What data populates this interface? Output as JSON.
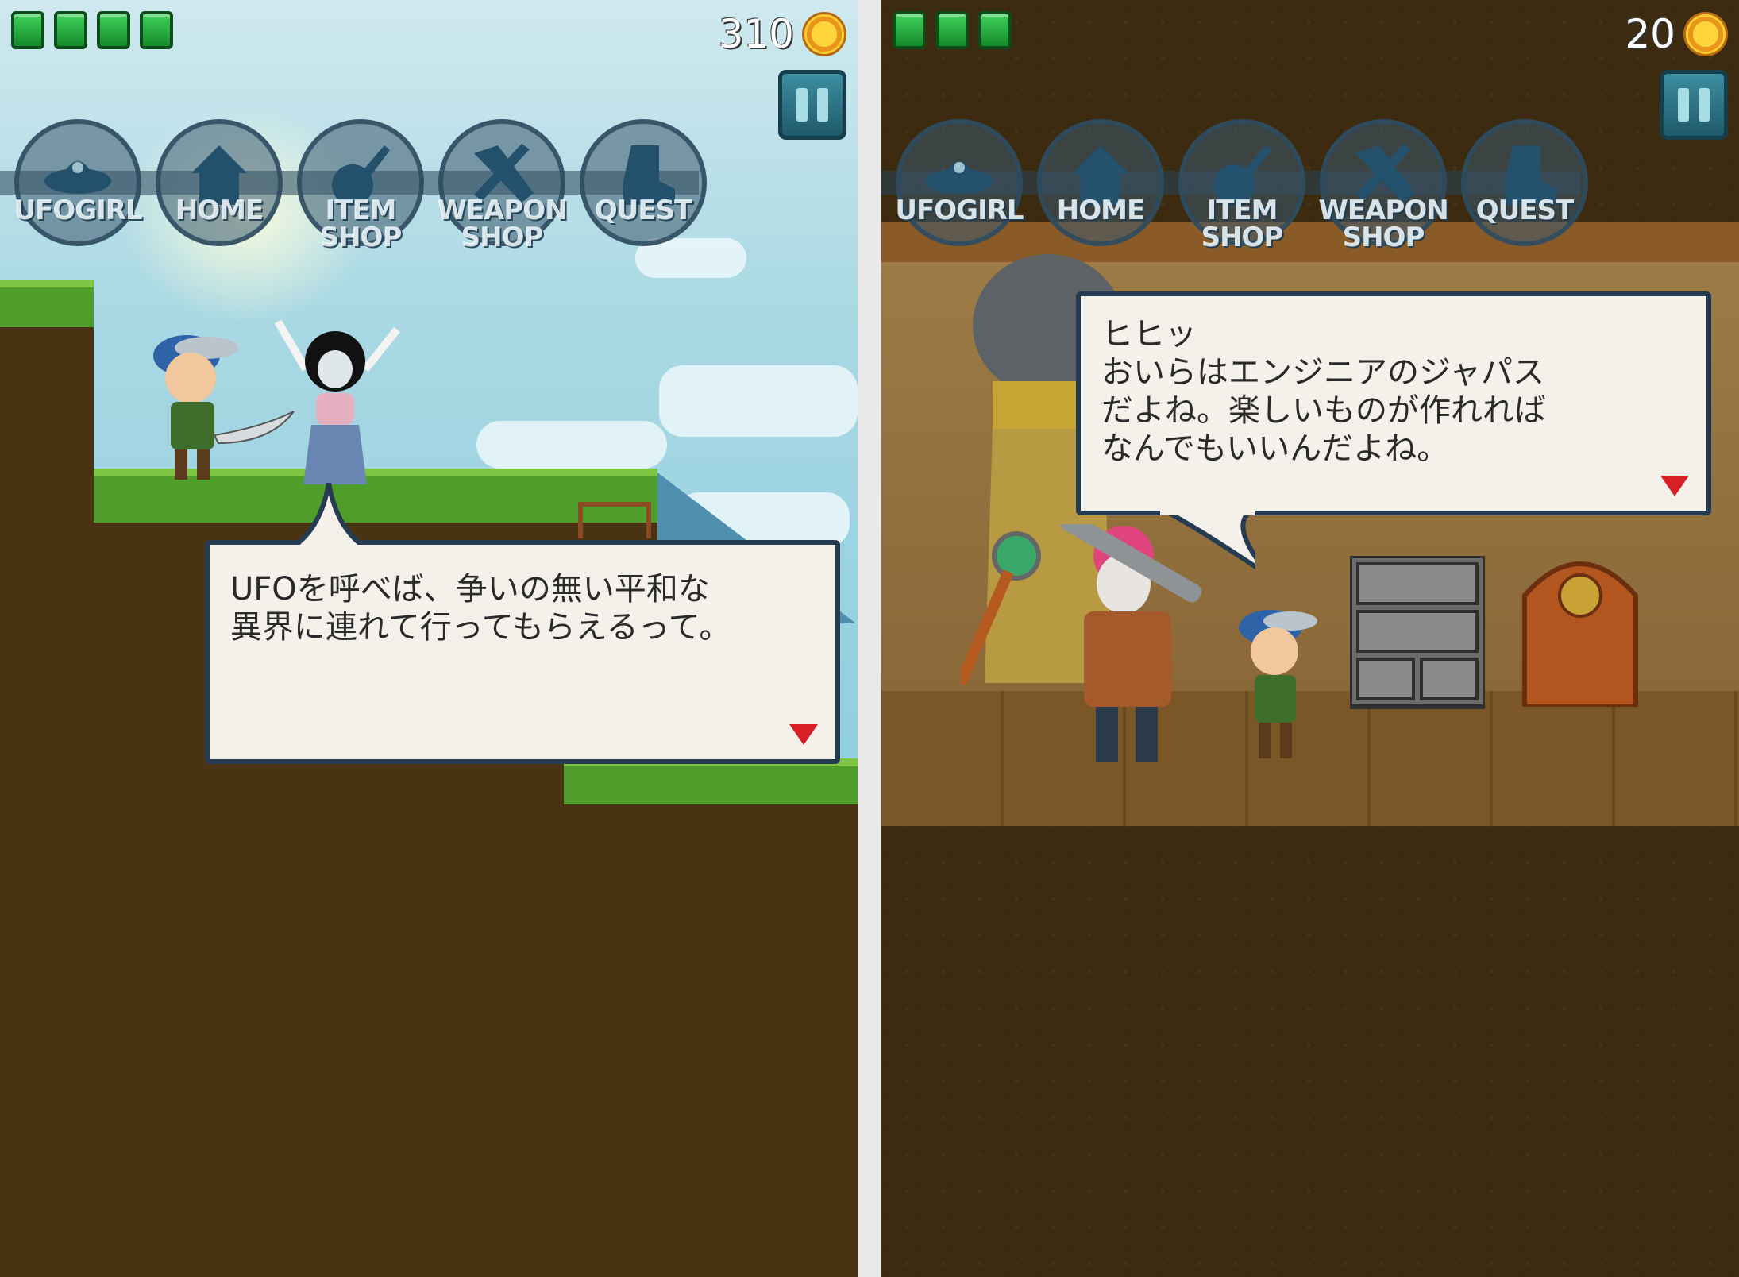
{
  "left_screen": {
    "lives": 4,
    "coin_count": "310",
    "menu": [
      {
        "label": "UFOGIRL",
        "icon": "ufo-icon"
      },
      {
        "label": "HOME",
        "icon": "home-icon"
      },
      {
        "label": "ITEM\nSHOP",
        "icon": "item-shop-icon"
      },
      {
        "label": "WEAPON\nSHOP",
        "icon": "weapon-shop-icon"
      },
      {
        "label": "QUEST",
        "icon": "quest-boot-icon"
      }
    ],
    "dialog": {
      "line1": "UFOを呼べば、争いの無い平和な",
      "line2": "異界に連れて行ってもらえるって。"
    }
  },
  "right_screen": {
    "lives": 3,
    "coin_count": "20",
    "menu": [
      {
        "label": "UFOGIRL",
        "icon": "ufo-icon"
      },
      {
        "label": "HOME",
        "icon": "home-icon"
      },
      {
        "label": "ITEM\nSHOP",
        "icon": "item-shop-icon"
      },
      {
        "label": "WEAPON\nSHOP",
        "icon": "weapon-shop-icon"
      },
      {
        "label": "QUEST",
        "icon": "quest-boot-icon"
      }
    ],
    "dialog": {
      "line1": "ヒヒッ",
      "line2": "おいらはエンジニアのジャパス",
      "line3": "だよね。楽しいものが作れれば",
      "line4": "なんでもいいんだよね。"
    }
  },
  "colors": {
    "life_green": "#2fb84a",
    "dialog_border": "#253b52",
    "next_arrow": "#d81f26",
    "coin_gold": "#ffcc33"
  }
}
